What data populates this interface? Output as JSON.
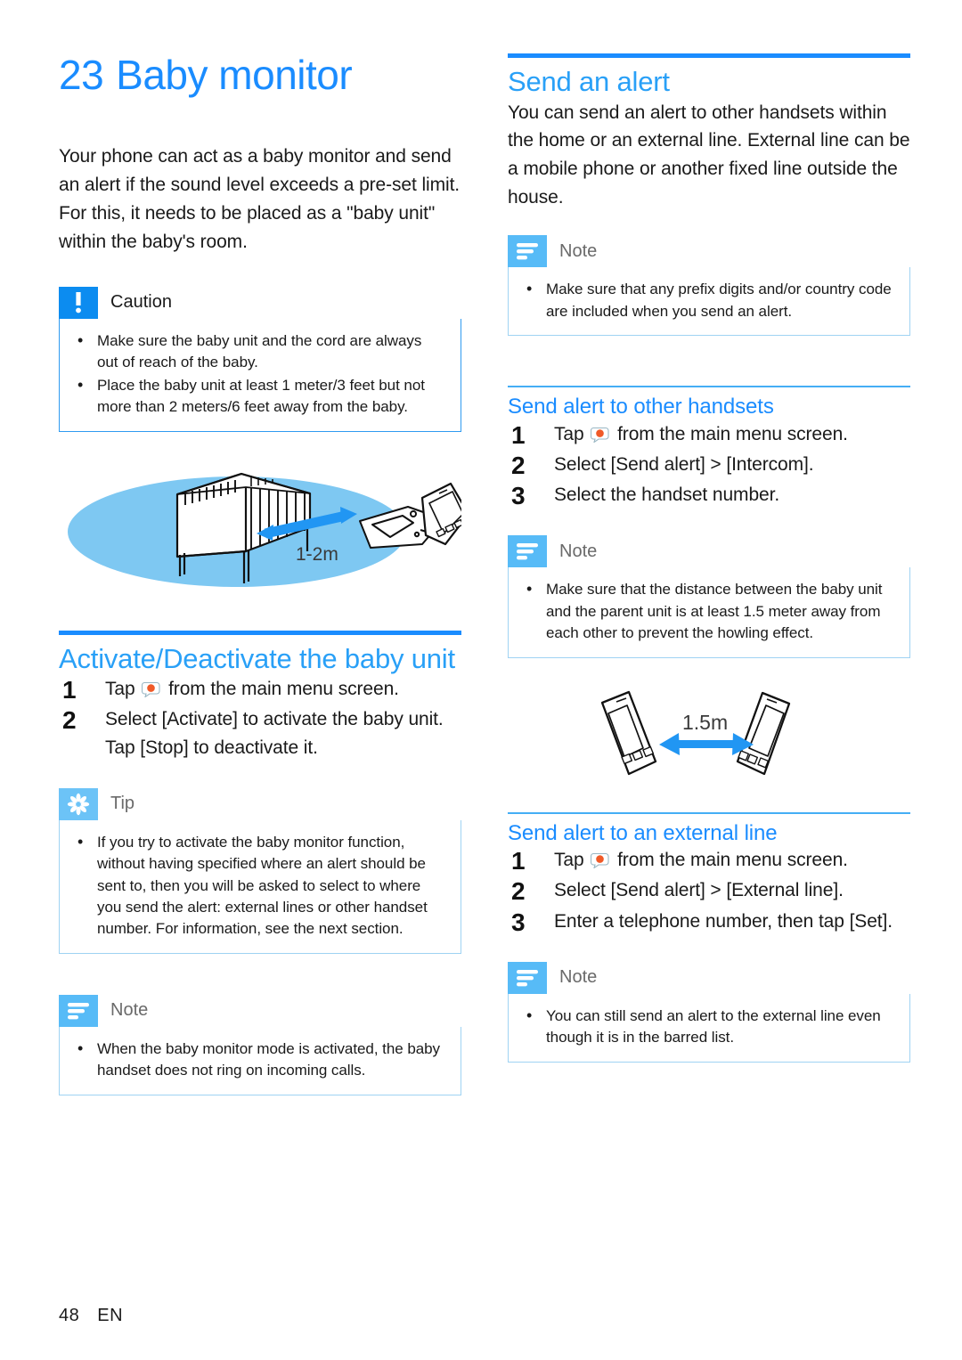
{
  "document": {
    "chapter_number": "23",
    "chapter_title": "Baby monitor",
    "footer_page": "48",
    "footer_lang": "EN"
  },
  "colors": {
    "heading_blue": "#1a8cff",
    "subheading_blue": "#29a0f7",
    "rule_blue": "#1a8cff",
    "thin_rule_blue": "#45aef5",
    "note_badge": "#57bbf7",
    "tip_badge": "#6cc3f7",
    "caution_badge": "#0c8cf0",
    "callout_border": "#9fd3f3",
    "figure_ellipse": "#7ec8f2",
    "figure_arrow": "#2196f3",
    "tap_icon_dot": "#f05a28"
  },
  "left_column": {
    "intro_paragraph": "Your phone can act as a baby monitor and send an alert if the sound level exceeds a pre-set limit. For this, it needs to be placed as a \"baby unit\" within the baby's room.",
    "caution": {
      "title": "Caution",
      "icon": "exclamation-icon",
      "items": [
        "Make sure the baby unit and the cord are always out of reach of the baby.",
        "Place the baby unit at least 1 meter/3 feet but not more than 2 meters/6 feet away from the baby."
      ]
    },
    "figure_crib": {
      "name": "crib-and-handset-distance-figure",
      "distance_label": "1-2m"
    },
    "activate_section": {
      "heading": "Activate/Deactivate the baby unit",
      "steps": [
        {
          "pre": "Tap",
          "icon": "baby-monitor-icon",
          "post": "from the main menu screen."
        },
        {
          "pre": "",
          "icon": "",
          "post": "Select [Activate] to activate the baby unit. Tap [Stop] to deactivate it."
        }
      ]
    },
    "tip": {
      "title": "Tip",
      "icon": "asterisk-icon",
      "items": [
        "If you try to activate the baby monitor function, without having specified where an alert should be sent to, then you will be asked to select to where you send the alert: external lines or other handset number. For information, see the next section."
      ]
    },
    "note": {
      "title": "Note",
      "icon": "note-lines-icon",
      "items": [
        "When the baby monitor mode is activated, the baby handset does not ring on incoming calls."
      ]
    }
  },
  "right_column": {
    "send_alert_section": {
      "heading": "Send an alert",
      "paragraph": "You can send an alert to other handsets within the home or an external line. External line can be a mobile phone or another fixed line outside the house.",
      "note": {
        "title": "Note",
        "icon": "note-lines-icon",
        "items": [
          "Make sure that any prefix digits and/or country code are included when you send an alert."
        ]
      }
    },
    "other_handsets_section": {
      "heading": "Send alert to other handsets",
      "steps": [
        {
          "pre": "Tap",
          "icon": "baby-monitor-icon",
          "post": "from the main menu screen."
        },
        {
          "pre": "",
          "icon": "",
          "post": "Select [Send alert] > [Intercom]."
        },
        {
          "pre": "",
          "icon": "",
          "post": "Select the handset number."
        }
      ],
      "note": {
        "title": "Note",
        "icon": "note-lines-icon",
        "items": [
          "Make sure that the distance between the baby unit and the parent unit is at least 1.5 meter away from each other to prevent the howling effect."
        ]
      },
      "figure_handsets": {
        "name": "two-handsets-distance-figure",
        "distance_label": "1.5m"
      }
    },
    "external_line_section": {
      "heading": "Send alert to an external line",
      "steps": [
        {
          "pre": "Tap",
          "icon": "baby-monitor-icon",
          "post": "from the main menu screen."
        },
        {
          "pre": "",
          "icon": "",
          "post": "Select [Send alert] > [External line]."
        },
        {
          "pre": "",
          "icon": "",
          "post": "Enter a telephone number, then tap [Set]."
        }
      ],
      "note": {
        "title": "Note",
        "icon": "note-lines-icon",
        "items": [
          "You can still send an alert to the external line even though it is in the barred list."
        ]
      }
    }
  }
}
